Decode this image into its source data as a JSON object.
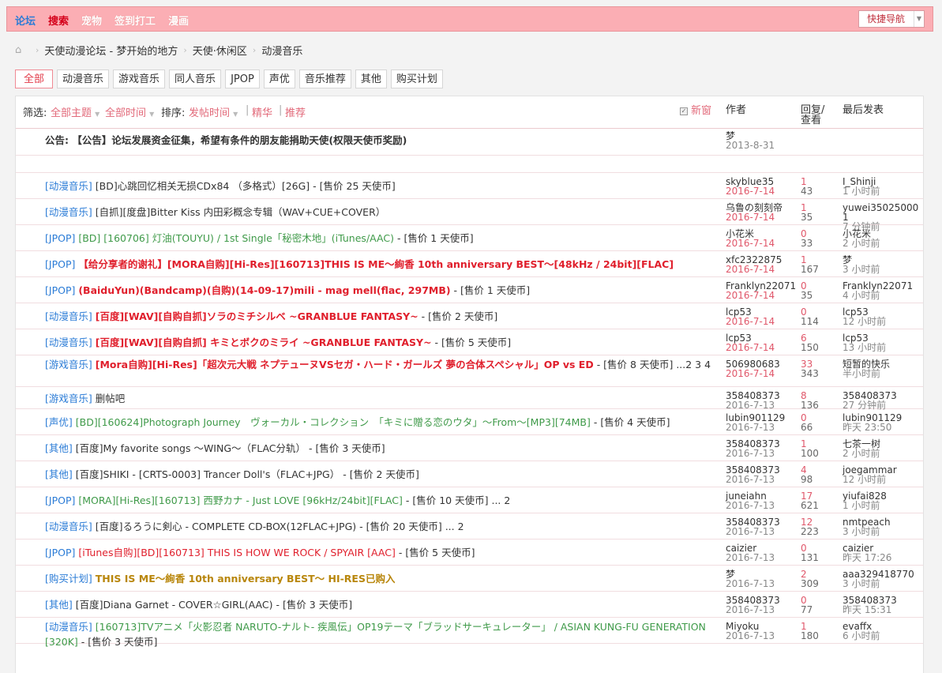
{
  "topnav": {
    "items": [
      "论坛",
      "搜索",
      "宠物",
      "签到打工",
      "漫画"
    ],
    "quick_nav": "快捷导航"
  },
  "breadcrumb": [
    "天使动漫论坛 - 梦开始的地方",
    "天使·休闲区",
    "动漫音乐"
  ],
  "tabs": [
    "全部",
    "动漫音乐",
    "游戏音乐",
    "同人音乐",
    "JPOP",
    "声优",
    "音乐推荐",
    "其他",
    "购买计划"
  ],
  "filter": {
    "label": "筛选:",
    "all_topics": "全部主题",
    "all_time": "全部时间",
    "sort_label": "排序:",
    "sort_value": "发帖时间",
    "digest": "精华",
    "recommend": "推荐",
    "new_window": "新窗"
  },
  "headers": {
    "author": "作者",
    "reply_view": "回复/查看",
    "last_post": "最后发表"
  },
  "announcement": {
    "prefix": "公告:",
    "title": "【公告】论坛发展资金征集，希望有条件的朋友能捐助天使(权限天使币奖励)",
    "author": "梦",
    "date": "2013-8-31"
  },
  "threads": [
    {
      "cat": "[动漫音乐]",
      "title": "[BD]心跳回忆相关无损CDx84 （多格式）[26G]",
      "suffix": " - [售价 25 天使币]",
      "author": "skyblue35",
      "date": "2016-7-14",
      "replies": "1",
      "views": "43",
      "last_user": "I_Shinji",
      "last_time": "1 小时前"
    },
    {
      "cat": "[动漫音乐]",
      "title": "[自抓][度盘]Bitter Kiss 内田彩概念专辑（WAV+CUE+COVER）",
      "suffix": "",
      "author": "乌鲁の刻刻帝",
      "date": "2016-7-14",
      "replies": "1",
      "views": "35",
      "last_user": "yuwei350250001",
      "last_time": "7 分钟前"
    },
    {
      "cat": "[JPOP]",
      "title": "[BD] [160706] 灯油(TOUYU) / 1st Single「秘密木地」(iTunes/AAC)",
      "suffix": " - [售价 1 天使币]",
      "author": "小花米",
      "date": "2016-7-14",
      "replies": "0",
      "views": "33",
      "last_user": "小花米",
      "last_time": "2 小时前"
    },
    {
      "cat": "[JPOP]",
      "title": "【给分享者的谢礼】[MORA自购][Hi-Res][160713]THIS IS ME～絢香 10th anniversary BEST～[48kHz / 24bit][FLAC]",
      "suffix": "",
      "author": "xfc2322875",
      "date": "2016-7-14",
      "replies": "1",
      "views": "167",
      "last_user": "梦",
      "last_time": "3 小时前"
    },
    {
      "cat": "[JPOP]",
      "title": "(BaiduYun)(Bandcamp)(自购)(14-09-17)mili - mag mell(flac, 297MB)",
      "suffix": " - [售价 1 天使币]",
      "author": "Franklyn22071",
      "date": "2016-7-14",
      "replies": "0",
      "views": "35",
      "last_user": "Franklyn22071",
      "last_time": "4 小时前"
    },
    {
      "cat": "[动漫音乐]",
      "title": "[百度][WAV][自购自抓]ソラのミチシルベ ~GRANBLUE FANTASY~",
      "suffix": " - [售价 2 天使币]",
      "author": "lcp53",
      "date": "2016-7-14",
      "replies": "0",
      "views": "114",
      "last_user": "lcp53",
      "last_time": "12 小时前"
    },
    {
      "cat": "[动漫音乐]",
      "title": "[百度][WAV][自购自抓] キミとボクのミライ ~GRANBLUE FANTASY~",
      "suffix": " - [售价 5 天使币]",
      "author": "lcp53",
      "date": "2016-7-14",
      "replies": "6",
      "views": "150",
      "last_user": "lcp53",
      "last_time": "13 小时前"
    },
    {
      "cat": "[游戏音乐]",
      "title": "[Mora自购][Hi-Res]「超次元大戦 ネプテューヌVSセガ・ハード・ガールズ 夢の合体スペシャル」OP vs ED",
      "suffix": " - [售价 8 天使币]",
      "pages": "...2 3 4",
      "author": "506980683",
      "date": "2016-7-14",
      "replies": "33",
      "views": "343",
      "last_user": "短暂的快乐",
      "last_time": "半小时前"
    },
    {
      "cat": "[游戏音乐]",
      "title": "删帖吧",
      "suffix": "",
      "author": "358408373",
      "date": "2016-7-13",
      "replies": "8",
      "views": "136",
      "last_user": "358408373",
      "last_time": "27 分钟前"
    },
    {
      "cat": "[声优]",
      "title": "[BD][160624]Photograph Journey　ヴォーカル・コレクション　「キミに贈る恋のウタ」～From～[MP3][74MB]",
      "suffix": " - [售价 4 天使币]",
      "author": "lubin901129",
      "date": "2016-7-13",
      "replies": "0",
      "views": "66",
      "last_user": "lubin901129",
      "last_time": "昨天 23:50"
    },
    {
      "cat": "[其他]",
      "title": "[百度]My favorite songs ～WING～（FLAC分轨）",
      "suffix": " - [售价 3 天使币]",
      "author": "358408373",
      "date": "2016-7-13",
      "replies": "1",
      "views": "100",
      "last_user": "七茶一树",
      "last_time": "2 小时前"
    },
    {
      "cat": "[其他]",
      "title": "[百度]SHIKI - [CRTS-0003] Trancer Doll's（FLAC+JPG）",
      "suffix": " - [售价 2 天使币]",
      "author": "358408373",
      "date": "2016-7-13",
      "replies": "4",
      "views": "98",
      "last_user": "joegammar",
      "last_time": "12 小时前"
    },
    {
      "cat": "[JPOP]",
      "title": "[MORA][Hi-Res][160713] 西野カナ - Just LOVE [96kHz/24bit][FLAC]",
      "suffix": " - [售价 10 天使币]",
      "pages": "... 2",
      "author": "juneiahn",
      "date": "2016-7-13",
      "replies": "17",
      "views": "621",
      "last_user": "yiufai828",
      "last_time": "1 小时前"
    },
    {
      "cat": "[动漫音乐]",
      "title": "[百度]るろうに剣心 - COMPLETE CD-BOX(12FLAC+JPG)",
      "suffix": " - [售价 20 天使币]",
      "pages": "... 2",
      "author": "358408373",
      "date": "2016-7-13",
      "replies": "12",
      "views": "223",
      "last_user": "nmtpeach",
      "last_time": "3 小时前"
    },
    {
      "cat": "[JPOP]",
      "title": "[iTunes自购][BD][160713] THIS IS HOW WE ROCK / SPYAIR [AAC]",
      "suffix": " - [售价 5 天使币]",
      "author": "caizier",
      "date": "2016-7-13",
      "replies": "0",
      "views": "131",
      "last_user": "caizier",
      "last_time": "昨天 17:26"
    },
    {
      "cat": "[购买计划]",
      "title": "THIS IS ME～絢香 10th anniversary BEST～ HI-RES已购入",
      "suffix": "",
      "author": "梦",
      "date": "2016-7-13",
      "replies": "2",
      "views": "309",
      "last_user": "aaa329418770",
      "last_time": "3 小时前"
    },
    {
      "cat": "[其他]",
      "title": "[百度]Diana Garnet - COVER☆GIRL(AAC)",
      "suffix": " - [售价 3 天使币]",
      "author": "358408373",
      "date": "2016-7-13",
      "replies": "0",
      "views": "77",
      "last_user": "358408373",
      "last_time": "昨天 15:31"
    },
    {
      "cat": "[动漫音乐]",
      "title": "[160713]TVアニメ「火影忍者 NARUTO-ナルト- 疾風伝」OP19テーマ「ブラッドサーキュレーター」 / ASIAN KUNG-FU GENERATION [320K]",
      "suffix": " - [售价 3 天使币]",
      "author": "Miyoku",
      "date": "2016-7-13",
      "replies": "1",
      "views": "180",
      "last_user": "evaffx",
      "last_time": "6 小时前"
    }
  ]
}
